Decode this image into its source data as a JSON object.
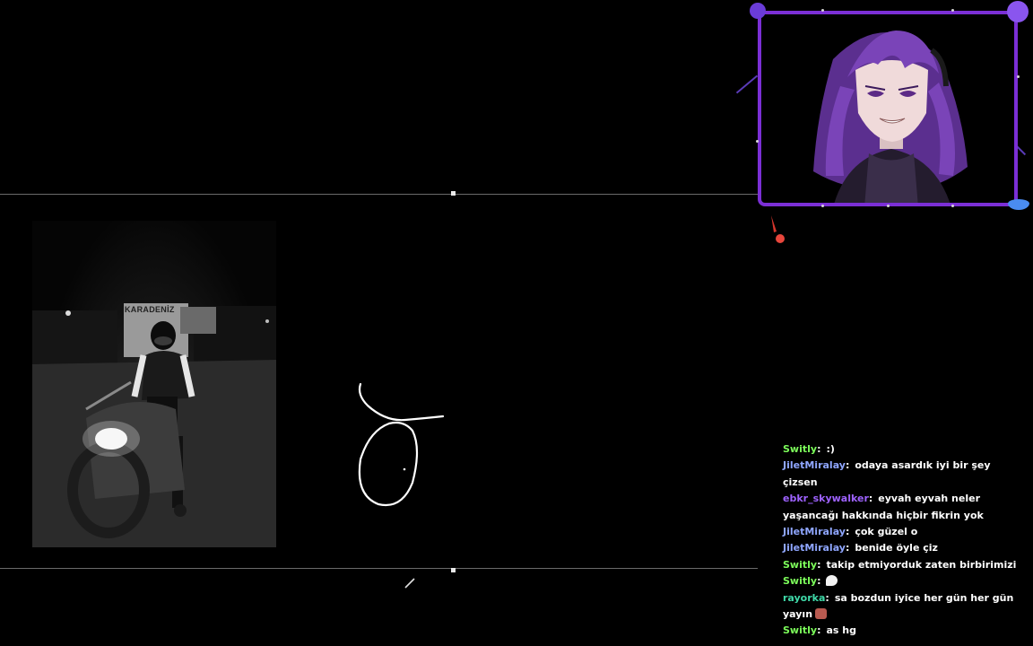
{
  "canvas": {
    "photo": {
      "sign_text": "KARADENİZ"
    }
  },
  "webcam": {
    "avatar": "anime-purple-hair-avatar"
  },
  "chat": {
    "messages": [
      {
        "user": "Switly",
        "color": "#7CFC5A",
        "text": ":)"
      },
      {
        "user": "JiletMiralay",
        "color": "#8fa6ff",
        "text": "odaya asardık iyi bir şey çizsen"
      },
      {
        "user": "ebkr_skywalker",
        "color": "#9e62ff",
        "text": "eyvah eyvah neler yaşancağı hakkında hiçbir fikrin yok"
      },
      {
        "user": "JiletMiralay",
        "color": "#8fa6ff",
        "text": "çok güzel o"
      },
      {
        "user": "JiletMiralay",
        "color": "#8fa6ff",
        "text": "benide öyle çiz"
      },
      {
        "user": "Switly",
        "color": "#7CFC5A",
        "text": "takip etmiyorduk zaten birbirimizi"
      },
      {
        "user": "Switly",
        "color": "#7CFC5A",
        "text": "",
        "emote": "speech-bubble-emote"
      },
      {
        "user": "rayorka",
        "color": "#3fd9a8",
        "text": "sa bozdun iyice her gün her gün yayın",
        "emote": "face-emote"
      },
      {
        "user": "Switly",
        "color": "#7CFC5A",
        "text": "as hg"
      }
    ]
  },
  "colors": {
    "frame": "#7b2fd6",
    "background": "#000000"
  }
}
